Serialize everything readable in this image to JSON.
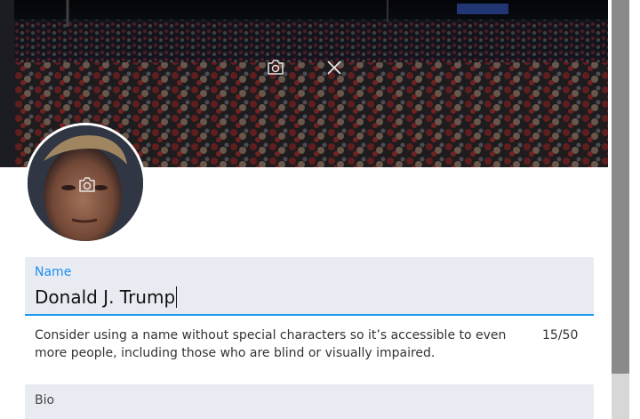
{
  "banner": {
    "camera_icon": "camera-icon",
    "close_icon": "close-icon"
  },
  "avatar": {
    "camera_icon": "camera-icon"
  },
  "name_field": {
    "label": "Name",
    "value": "Donald J. Trump",
    "helper_text": "Consider using a name without special characters so it’s accessible to even more people, including those who are blind or visually impaired.",
    "counter": "15/50",
    "accent_color": "#1d9bf0"
  },
  "bio_field": {
    "label": "Bio"
  }
}
